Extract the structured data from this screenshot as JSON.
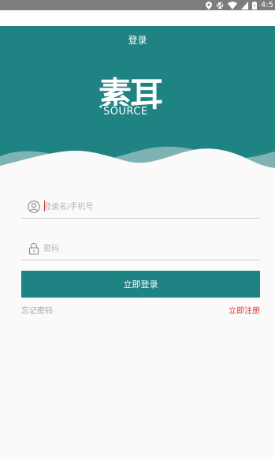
{
  "status_bar": {
    "time": "4:5",
    "icons": [
      "location-icon",
      "vibrate-icon",
      "wifi-icon",
      "signal-icon",
      "battery-icon"
    ]
  },
  "header": {
    "title": "登录",
    "logo_cn": "素耳",
    "logo_en": "SOURCE",
    "background_color": "#1f8384"
  },
  "form": {
    "username": {
      "placeholder": "登录名/手机号",
      "value": "",
      "icon": "user-icon"
    },
    "password": {
      "placeholder": "密码",
      "value": "",
      "icon": "lock-icon"
    },
    "login_label": "立即登录",
    "forgot_label": "忘记密码",
    "register_label": "立即注册"
  },
  "colors": {
    "accent": "#1f8384",
    "link_red": "#e53935",
    "muted_text": "#a6a6a6"
  }
}
